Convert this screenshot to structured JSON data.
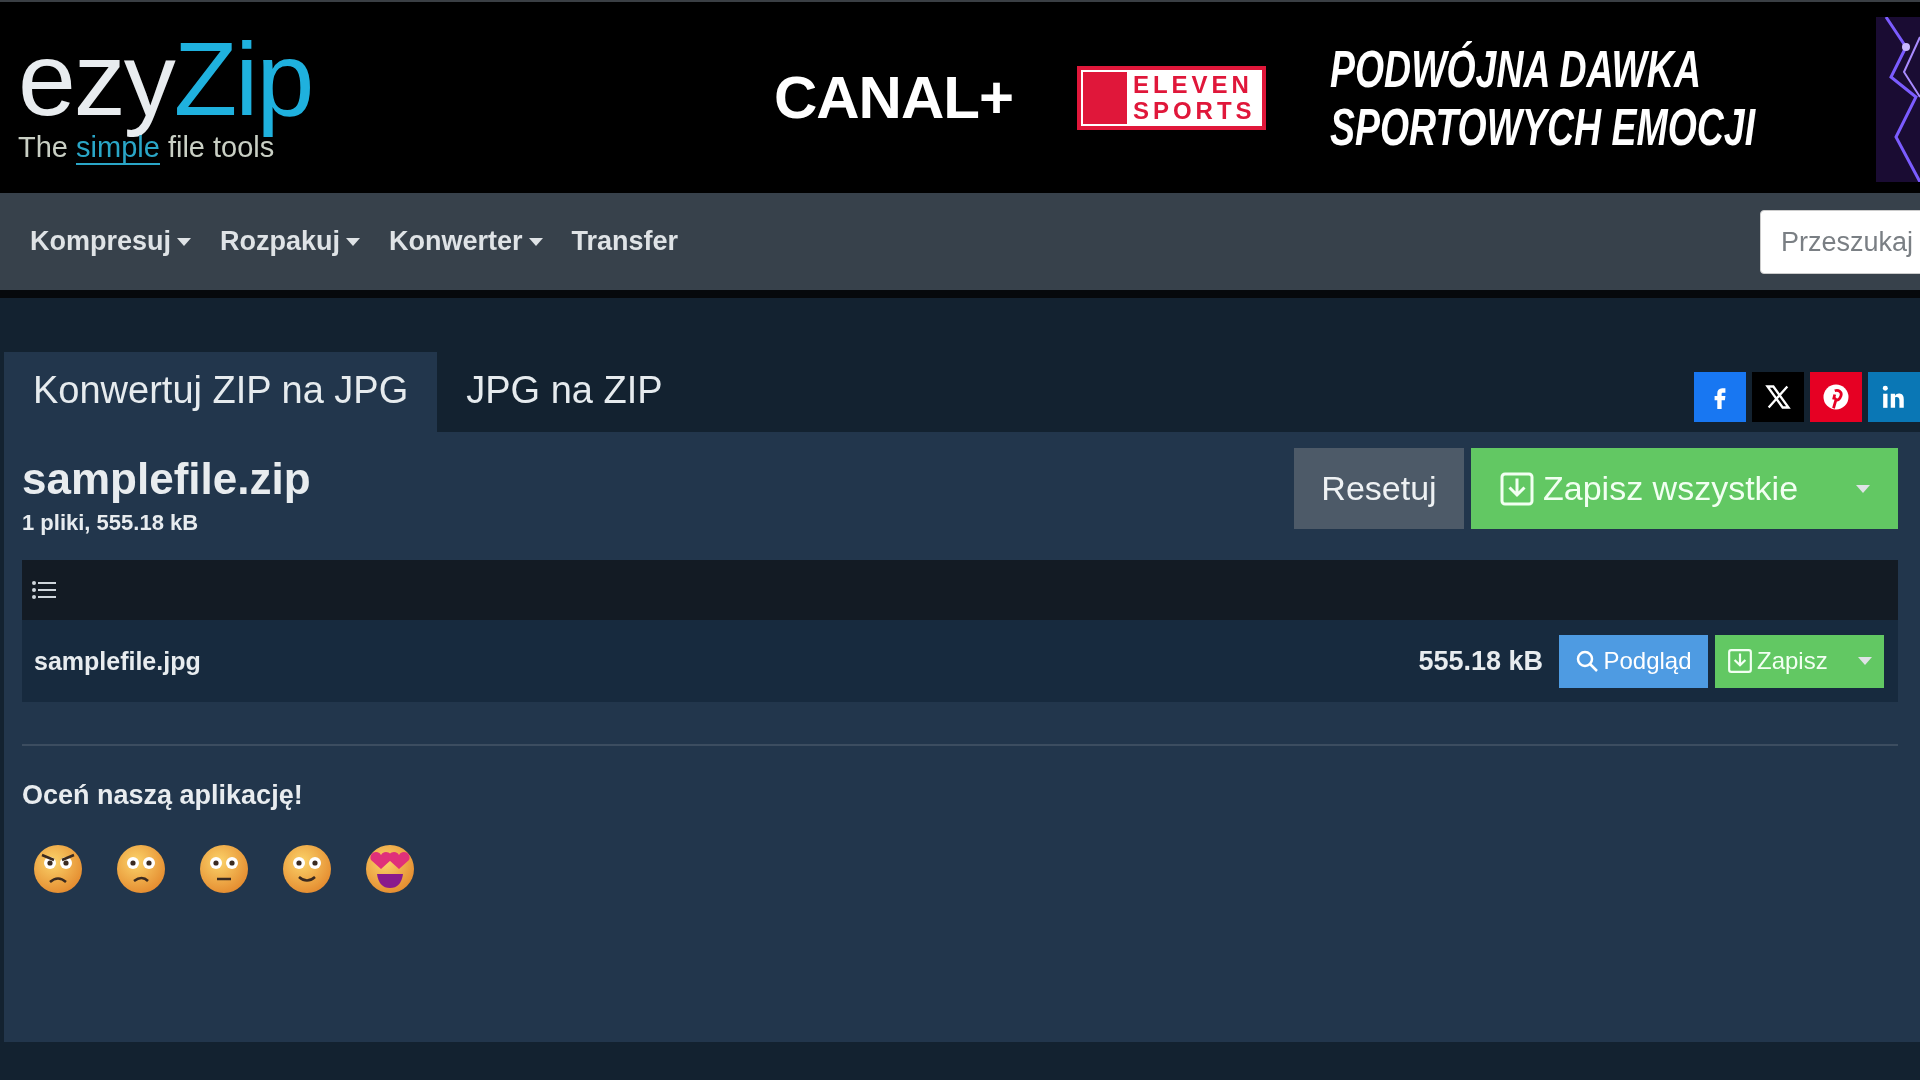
{
  "logo": {
    "part_1": "ezy",
    "part_2": "Zip",
    "tagline_start": "The",
    "tagline_highlight": "simple",
    "tagline_end": "file tools"
  },
  "ad": {
    "brand_1": "CANAL+",
    "brand_2_line_1": "ELEVEN",
    "brand_2_line_2": "SPORTS",
    "slogan_line_1": "PODWÓJNA DAWKA",
    "slogan_line_2": "SPORTOWYCH EMOCJI"
  },
  "nav": {
    "items": [
      {
        "label": "Kompresuj",
        "dropdown": true
      },
      {
        "label": "Rozpakuj",
        "dropdown": true
      },
      {
        "label": "Konwerter",
        "dropdown": true
      },
      {
        "label": "Transfer",
        "dropdown": false
      }
    ],
    "search": {
      "placeholder": "Przeszukaj"
    }
  },
  "tabs": [
    {
      "label": "Konwertuj ZIP na JPG",
      "selected": true
    },
    {
      "label": "JPG na ZIP",
      "selected": false
    }
  ],
  "share": [
    {
      "kind": "facebook"
    },
    {
      "kind": "x"
    },
    {
      "kind": "pinterest"
    },
    {
      "kind": "linkedin"
    }
  ],
  "archive": {
    "title": "samplefile.zip",
    "summary": "1 pliki, 555.18 kB",
    "reset_button": "Resetuj",
    "save_all_button": "Zapisz wszystkie"
  },
  "files": [
    {
      "name": "samplefile.jpg",
      "size": "555.18 kB",
      "preview_button": "Podgląd",
      "save_button": "Zapisz"
    }
  ],
  "rating": {
    "title": "Oceń naszą aplikację!",
    "options": [
      {
        "kind": "angry"
      },
      {
        "kind": "sad"
      },
      {
        "kind": "neutral"
      },
      {
        "kind": "happy"
      },
      {
        "kind": "love"
      }
    ]
  }
}
